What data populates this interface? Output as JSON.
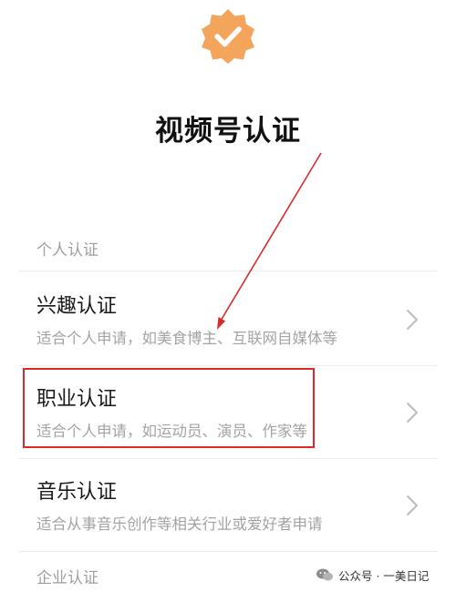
{
  "header": {
    "title": "视频号认证",
    "badge_icon": "verified-check-badge-icon",
    "badge_color": "#f3a55b"
  },
  "sections": {
    "personal": {
      "label": "个人认证",
      "items": [
        {
          "title": "兴趣认证",
          "desc": "适合个人申请，如美食博主、互联网自媒体等"
        },
        {
          "title": "职业认证",
          "desc": "适合个人申请，如运动员、演员、作家等"
        },
        {
          "title": "音乐认证",
          "desc": "适合从事音乐创作等相关行业或爱好者申请"
        }
      ]
    },
    "enterprise": {
      "label": "企业认证"
    }
  },
  "annotation": {
    "color": "#d92b2b"
  },
  "watermark": {
    "text": "公众号 · 一美日记"
  }
}
